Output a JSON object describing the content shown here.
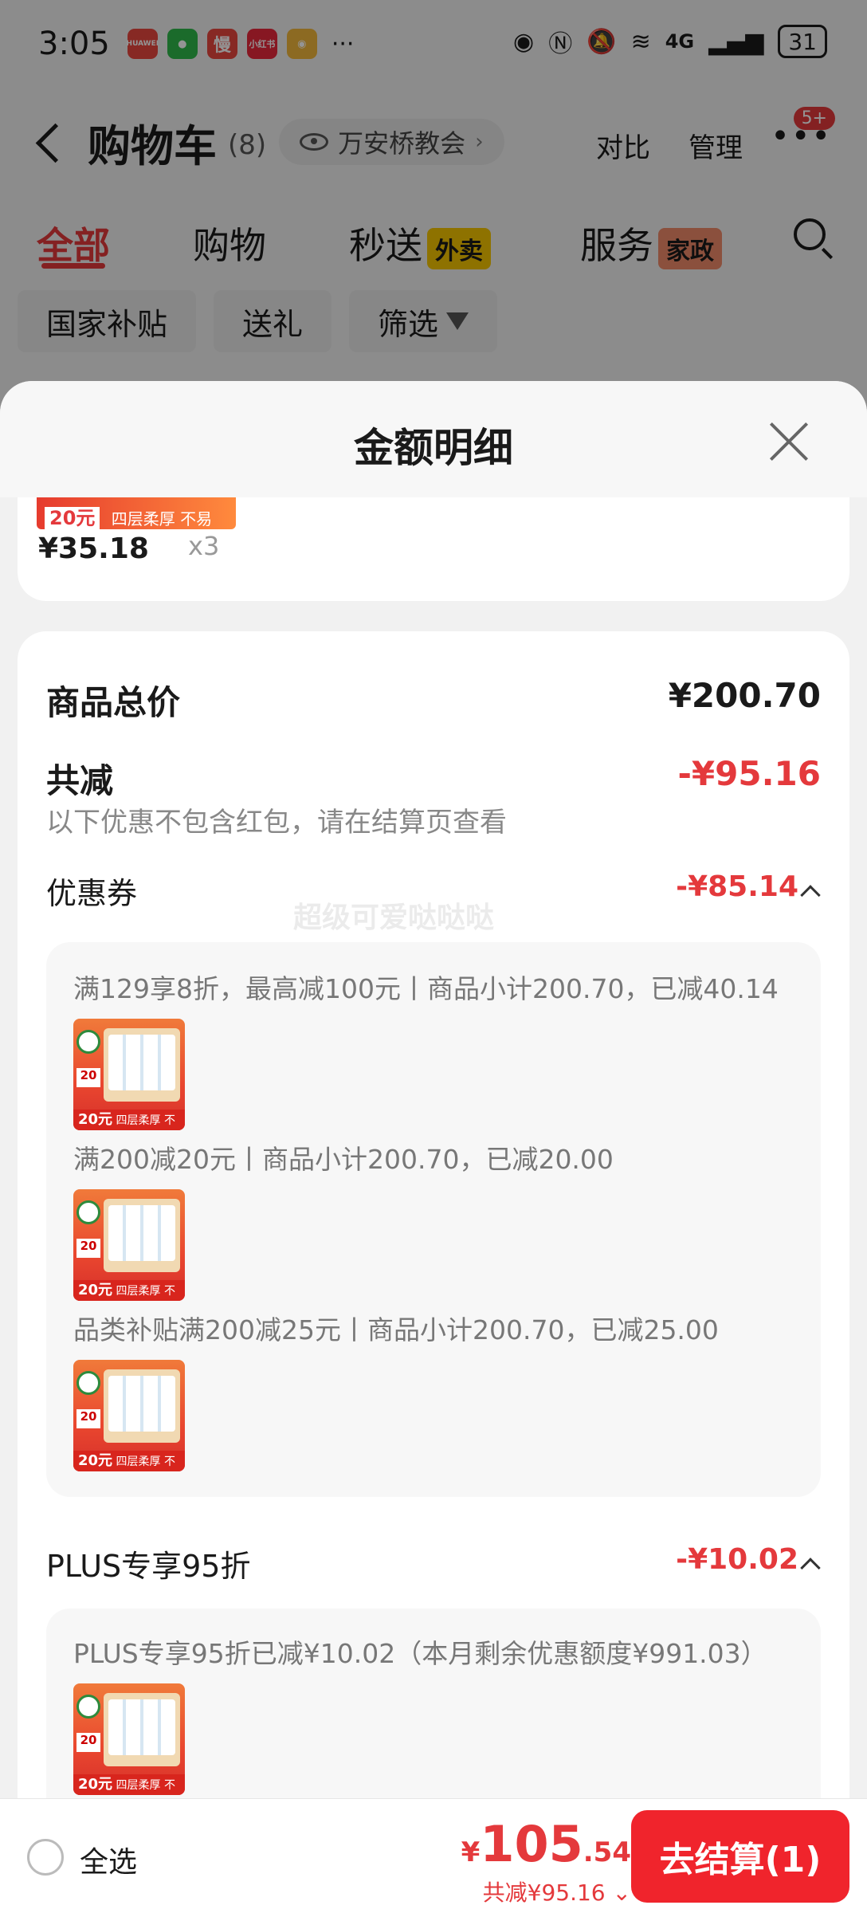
{
  "status_bar": {
    "time": "3:05",
    "app_icons": [
      {
        "name": "huawei-app-icon",
        "label": "HUAWEI",
        "color": "#e9473f"
      },
      {
        "name": "wechat-icon",
        "label": "",
        "color": "#2fb84b"
      },
      {
        "name": "man-app-icon",
        "label": "慢",
        "color": "#e9473f"
      },
      {
        "name": "xiaohongshu-icon",
        "label": "小红书",
        "color": "#e8293c"
      },
      {
        "name": "weibo-icon",
        "label": "",
        "color": "#f2b73c"
      }
    ],
    "more": "···",
    "network": "4G",
    "battery": "31"
  },
  "nav": {
    "title": "购物车",
    "count": "(8)",
    "address": "万安桥教会",
    "compare": "对比",
    "manage": "管理",
    "more_badge": "5+"
  },
  "tabs": [
    {
      "label": "全部",
      "active": true
    },
    {
      "label": "购物",
      "active": false
    },
    {
      "label": "秒送",
      "tag": "外卖",
      "tag_color": "#f5c400"
    },
    {
      "label": "服务",
      "tag": "家政",
      "tag_color": "#f08a6a"
    }
  ],
  "chips": [
    "国家补贴",
    "送礼",
    "筛选"
  ],
  "sheet": {
    "title": "金额明细",
    "item": {
      "price": "¥35.18",
      "qty": "x3",
      "promo": "四层柔厚 不易分层",
      "promo_price": "20元"
    },
    "total_label": "商品总价",
    "total_value": "¥200.70",
    "discount_label": "共减",
    "discount_value": "-¥95.16",
    "discount_note": "以下优惠不包含红包，请在结算页查看",
    "coupon": {
      "label": "优惠券",
      "value": "-¥85.14",
      "lines": [
        "满129享8折，最高减100元丨商品小计200.70，已减40.14",
        "满200减20元丨商品小计200.70，已减20.00",
        "品类补贴满200减25元丨商品小计200.70，已减25.00"
      ]
    },
    "plus": {
      "label": "PLUS专享95折",
      "value": "-¥10.02",
      "line": "PLUS专享95折已减¥10.02（本月剩余优惠额度¥991.03）"
    },
    "watermark": "超级可爱哒哒哒",
    "product_image": {
      "bottom_price": "20元",
      "bottom_text": "四层柔厚 不易分层",
      "badge": "20"
    }
  },
  "bottom_bar": {
    "select_all": "全选",
    "currency": "¥",
    "price_int": "105",
    "price_dec": ".54",
    "saved": "共减¥95.16",
    "checkout": "去结算(1)"
  },
  "colors": {
    "accent": "#e4393c",
    "checkout_button": "#f0242c"
  }
}
